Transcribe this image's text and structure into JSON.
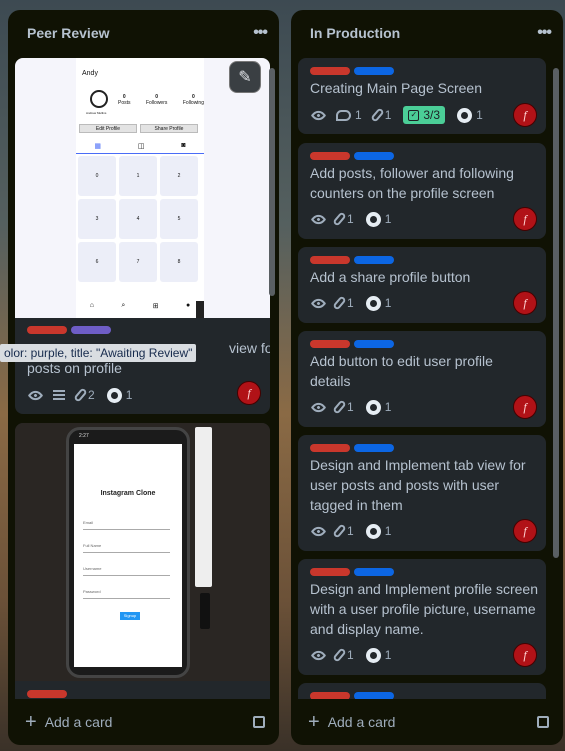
{
  "board": {
    "colors": {
      "list_bg": "#101204",
      "card_bg": "#22272b",
      "label_red": "#c9372c",
      "label_blue": "#0c66e4",
      "label_purple": "#6e5dc6",
      "check_green": "#4bce97"
    }
  },
  "lists": [
    {
      "title": "Peer Review",
      "menu_icon": "ellipsis-icon",
      "add_card": "Add a card",
      "cards": [
        {
          "cover": "profile-screen-mockup",
          "mockup": {
            "username": "Andy",
            "display_name": "Andrew Mullins",
            "stats": [
              {
                "n": "0",
                "label": "Posts"
              },
              {
                "n": "0",
                "label": "Followers"
              },
              {
                "n": "0",
                "label": "Following"
              }
            ],
            "buttons": [
              "Edit Profile",
              "Share Profile"
            ],
            "cells": [
              "0",
              "1",
              "2",
              "3",
              "4",
              "5",
              "6",
              "7",
              "8"
            ]
          },
          "tooltip": "olor: purple, title: \"Awaiting Review\"",
          "title_line1": "view for",
          "title_line2": "posts on profile",
          "labels": [
            "red",
            "purple"
          ],
          "badges": {
            "attachments": "2",
            "github": "1"
          }
        },
        {
          "cover": "signup-screen-mockup",
          "mockup": {
            "status_time": "2:27",
            "app_title": "Instagram Clone",
            "fields": [
              "Email",
              "Full Name",
              "Username",
              "Password"
            ],
            "button": "Signup"
          },
          "labels": [
            "red"
          ]
        }
      ]
    },
    {
      "title": "In Production",
      "menu_icon": "ellipsis-icon",
      "add_card": "Add a card",
      "cards": [
        {
          "title": "Creating Main Page Screen",
          "badges": {
            "comments": "1",
            "attachments": "1",
            "checklist": "3/3",
            "github": "1"
          }
        },
        {
          "title": "Add posts, follower and following counters on the profile screen",
          "badges": {
            "attachments": "1",
            "github": "1"
          }
        },
        {
          "title": "Add a share profile button",
          "badges": {
            "attachments": "1",
            "github": "1"
          }
        },
        {
          "title": "Add button to edit user profile details",
          "badges": {
            "attachments": "1",
            "github": "1"
          }
        },
        {
          "title": "Design and Implement tab view for user posts and posts with user tagged in them",
          "badges": {
            "attachments": "1",
            "github": "1"
          }
        },
        {
          "title": "Design and Implement profile screen with a user profile picture, username and display name.",
          "badges": {
            "attachments": "1",
            "github": "1"
          }
        },
        {
          "title": "",
          "badges": {}
        }
      ]
    }
  ]
}
